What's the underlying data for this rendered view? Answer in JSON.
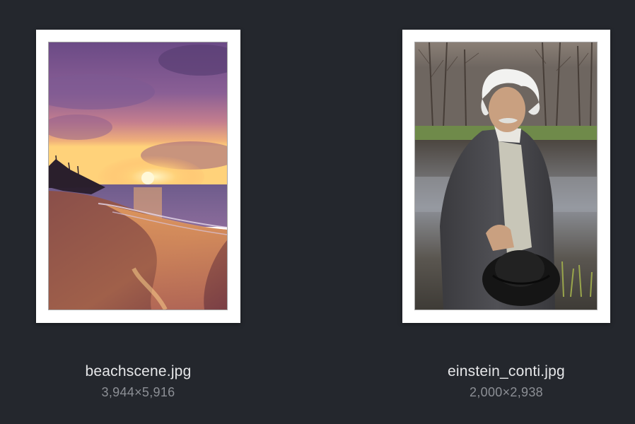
{
  "files": [
    {
      "name": "beachscene.jpg",
      "dimensions": "3,944×5,916",
      "thumbnail_icon": "beach-sunset-photo"
    },
    {
      "name": "einstein_conti.jpg",
      "dimensions": "2,000×2,938",
      "thumbnail_icon": "portrait-photo"
    }
  ],
  "colors": {
    "background": "#24272d",
    "frame": "#ffffff",
    "filename_text": "#e6e7e9",
    "dimensions_text": "#8c8f95"
  }
}
